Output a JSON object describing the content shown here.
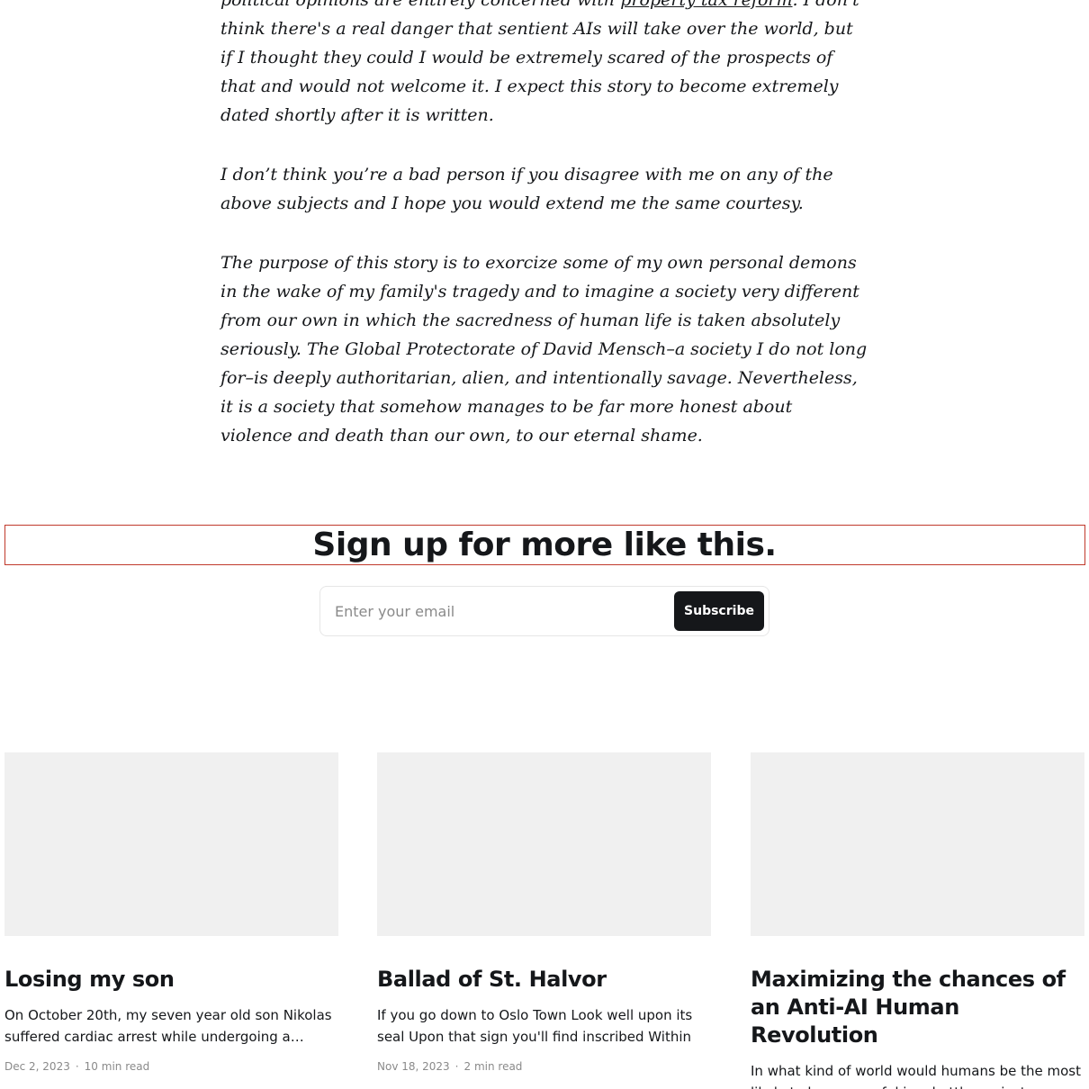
{
  "article": {
    "paragraphs": [
      {
        "before": "political opinions are entirely concerned with ",
        "link": "property tax reform",
        "after": ". I don't think there's a real danger that sentient AIs will take over the world, but if I thought they could I would be extremely scared of the prospects of that and would not welcome it. I expect this story to become extremely dated shortly after it is written."
      },
      {
        "text": "I don’t think you’re a bad person if you disagree with me on any of the above subjects and I hope you would extend me the same courtesy."
      },
      {
        "text": "The purpose of this story is to exorcize some of my own personal demons in the wake of my family's tragedy and to imagine a society very different from our own in which the sacredness of human life is taken absolutely seriously. The Global Protectorate of David Mensch–a society I do not long for–is deeply authoritarian, alien, and intentionally savage. Nevertheless, it is a society that somehow manages to be far more honest about violence and death than our own, to our eternal shame."
      }
    ]
  },
  "signup": {
    "heading": "Sign up for more like this.",
    "email_placeholder": "Enter your email",
    "button_label": "Subscribe"
  },
  "posts": [
    {
      "title": "Losing my son",
      "excerpt": "On October 20th, my seven year old son Nikolas suffered cardiac arrest while undergoing a…",
      "date": "Dec 2, 2023",
      "read_time": "10 min read"
    },
    {
      "title": "Ballad of St. Halvor",
      "excerpt": "If you go down to Oslo Town Look well upon its seal Upon that sign you'll find inscribed Within its…",
      "date": "Nov 18, 2023",
      "read_time": "2 min read"
    },
    {
      "title": "Maximizing the chances of an Anti-AI Human Revolution",
      "excerpt": "In what kind of world would humans be the most likely to be successful in a battle against a world…",
      "date": "",
      "read_time": ""
    }
  ]
}
